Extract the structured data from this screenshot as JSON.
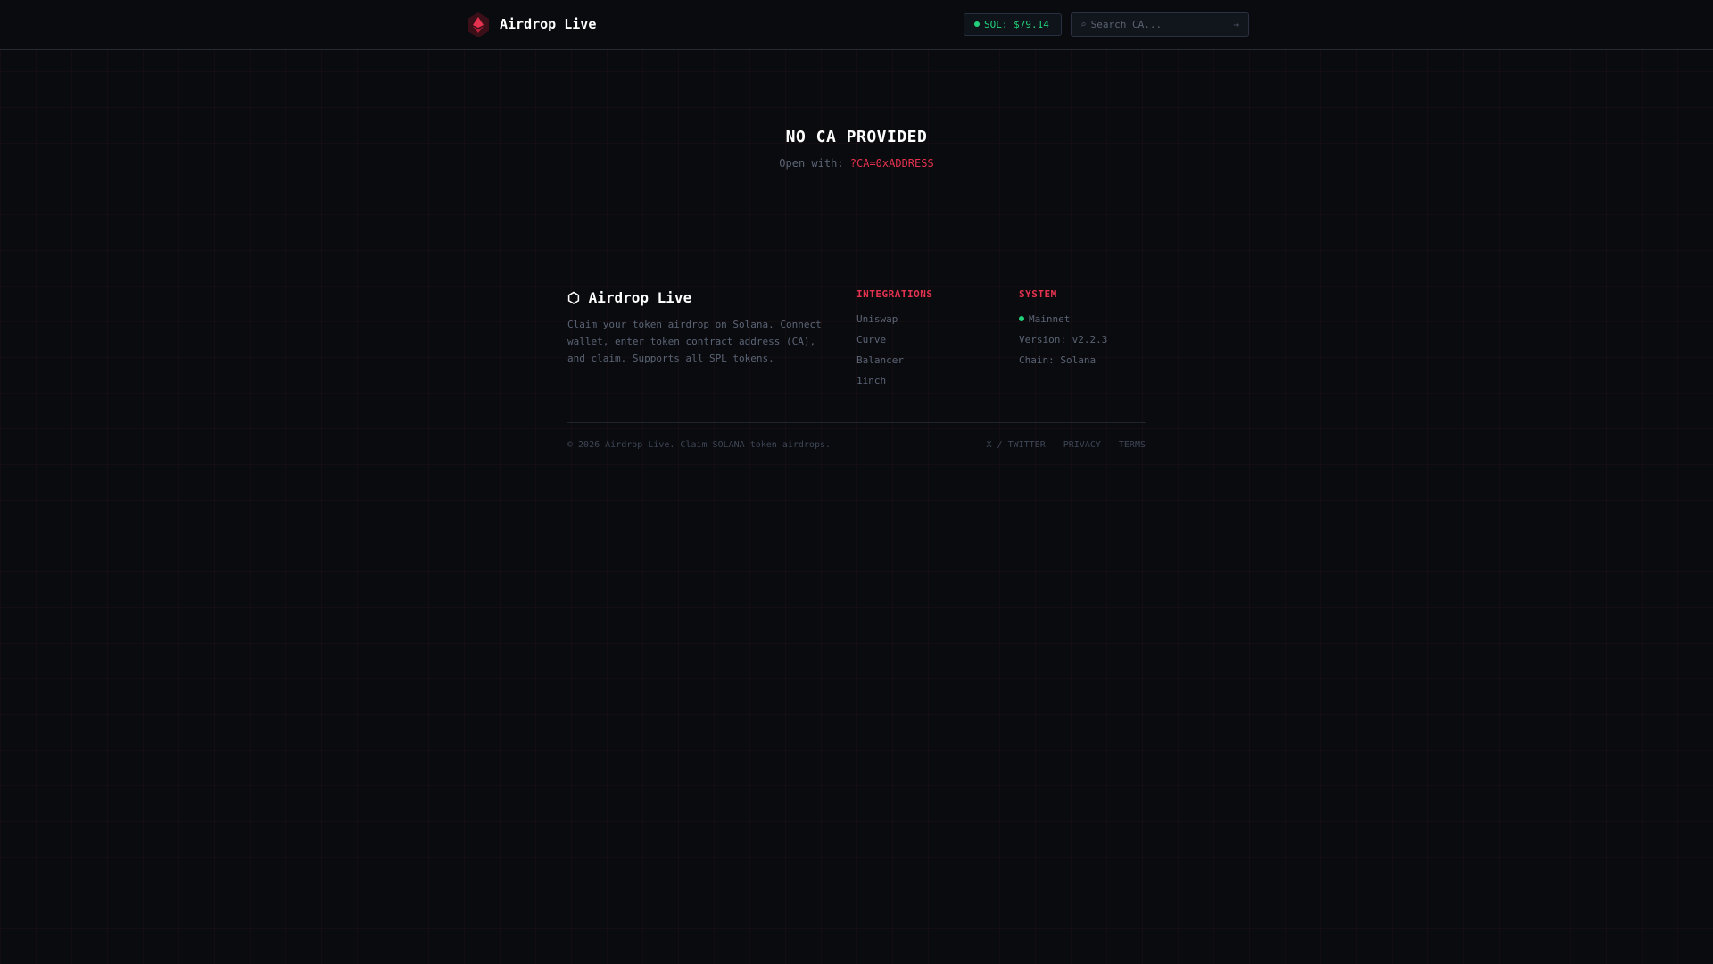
{
  "header": {
    "brand": "Airdrop Live",
    "sol_price": "SOL: $79.14",
    "search_placeholder": "Search CA...",
    "search_icon": "search-icon",
    "submit_icon": "arrow-right-icon"
  },
  "main": {
    "title": "NO CA PROVIDED",
    "hint_prefix": "Open with:",
    "hint_param": "?CA=0xADDRESS"
  },
  "footer": {
    "brand": "⬡ Airdrop Live",
    "description": "Claim your token airdrop on Solana. Connect wallet, enter token contract address (CA), and claim. Supports all SPL tokens.",
    "integrations": {
      "title": "INTEGRATIONS",
      "items": [
        "Uniswap",
        "Curve",
        "Balancer",
        "1inch"
      ]
    },
    "system": {
      "title": "SYSTEM",
      "network": "Mainnet",
      "version": "Version: v2.2.3",
      "chain": "Chain: Solana"
    },
    "copyright": "© 2026 Airdrop Live. Claim SOLANA token airdrops.",
    "links": [
      "X / TWITTER",
      "PRIVACY",
      "TERMS"
    ]
  },
  "colors": {
    "accent": "#e5324f",
    "status": "#22d17a",
    "background": "#0a0b0f"
  }
}
